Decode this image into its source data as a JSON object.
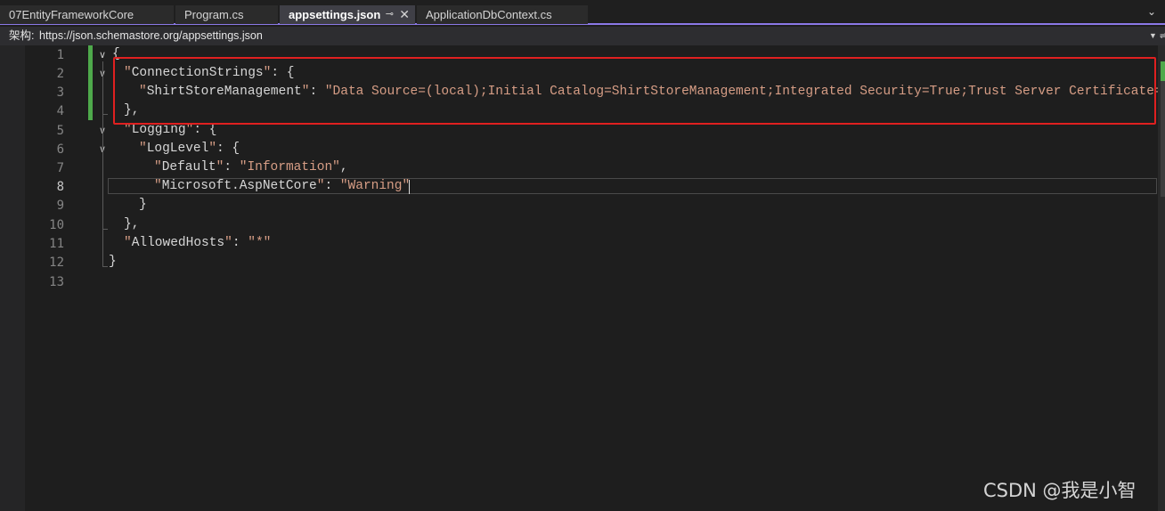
{
  "tabs": [
    {
      "label": "07EntityFrameworkCore"
    },
    {
      "label": "Program.cs"
    },
    {
      "label": "appsettings.json",
      "active": true,
      "pin_icon": "pin-icon",
      "close_icon": "close-icon"
    },
    {
      "label": "ApplicationDbContext.cs"
    }
  ],
  "tab_overflow_icon": "chevron-down-icon",
  "schema": {
    "label": "架构:",
    "url": "https://json.schemastore.org/appsettings.json"
  },
  "line_numbers": [
    "1",
    "2",
    "3",
    "4",
    "5",
    "6",
    "7",
    "8",
    "9",
    "10",
    "11",
    "12",
    "13"
  ],
  "current_line": "8",
  "code": {
    "l1": "{",
    "l2_key": "ConnectionStrings",
    "l3_key": "ShirtStoreManagement",
    "l3_val": "Data Source=(local);Initial Catalog=ShirtStoreManagement;Integrated Security=True;Trust Server Certificate=",
    "l4": "},",
    "l5_key": "Logging",
    "l6_key": "LogLevel",
    "l7_key": "Default",
    "l7_val": "Information",
    "l8_key": "Microsoft.AspNetCore",
    "l8_val": "Warning",
    "l9": "}",
    "l10": "},",
    "l11_key": "AllowedHosts",
    "l11_val": "*",
    "l12": "}"
  },
  "watermark": "CSDN @我是小智",
  "colors": {
    "accent": "#8a78e6",
    "change_bar": "#4ea94b",
    "annotation_box": "#e02020",
    "string": "#d69d85"
  }
}
